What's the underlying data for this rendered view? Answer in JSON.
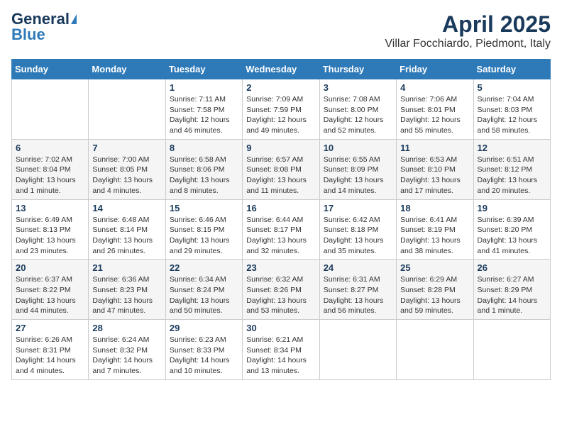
{
  "header": {
    "logo_general": "General",
    "logo_blue": "Blue",
    "title": "April 2025",
    "subtitle": "Villar Focchiardo, Piedmont, Italy"
  },
  "days_of_week": [
    "Sunday",
    "Monday",
    "Tuesday",
    "Wednesday",
    "Thursday",
    "Friday",
    "Saturday"
  ],
  "weeks": [
    [
      {
        "day": "",
        "detail": ""
      },
      {
        "day": "",
        "detail": ""
      },
      {
        "day": "1",
        "detail": "Sunrise: 7:11 AM\nSunset: 7:58 PM\nDaylight: 12 hours and 46 minutes."
      },
      {
        "day": "2",
        "detail": "Sunrise: 7:09 AM\nSunset: 7:59 PM\nDaylight: 12 hours and 49 minutes."
      },
      {
        "day": "3",
        "detail": "Sunrise: 7:08 AM\nSunset: 8:00 PM\nDaylight: 12 hours and 52 minutes."
      },
      {
        "day": "4",
        "detail": "Sunrise: 7:06 AM\nSunset: 8:01 PM\nDaylight: 12 hours and 55 minutes."
      },
      {
        "day": "5",
        "detail": "Sunrise: 7:04 AM\nSunset: 8:03 PM\nDaylight: 12 hours and 58 minutes."
      }
    ],
    [
      {
        "day": "6",
        "detail": "Sunrise: 7:02 AM\nSunset: 8:04 PM\nDaylight: 13 hours and 1 minute."
      },
      {
        "day": "7",
        "detail": "Sunrise: 7:00 AM\nSunset: 8:05 PM\nDaylight: 13 hours and 4 minutes."
      },
      {
        "day": "8",
        "detail": "Sunrise: 6:58 AM\nSunset: 8:06 PM\nDaylight: 13 hours and 8 minutes."
      },
      {
        "day": "9",
        "detail": "Sunrise: 6:57 AM\nSunset: 8:08 PM\nDaylight: 13 hours and 11 minutes."
      },
      {
        "day": "10",
        "detail": "Sunrise: 6:55 AM\nSunset: 8:09 PM\nDaylight: 13 hours and 14 minutes."
      },
      {
        "day": "11",
        "detail": "Sunrise: 6:53 AM\nSunset: 8:10 PM\nDaylight: 13 hours and 17 minutes."
      },
      {
        "day": "12",
        "detail": "Sunrise: 6:51 AM\nSunset: 8:12 PM\nDaylight: 13 hours and 20 minutes."
      }
    ],
    [
      {
        "day": "13",
        "detail": "Sunrise: 6:49 AM\nSunset: 8:13 PM\nDaylight: 13 hours and 23 minutes."
      },
      {
        "day": "14",
        "detail": "Sunrise: 6:48 AM\nSunset: 8:14 PM\nDaylight: 13 hours and 26 minutes."
      },
      {
        "day": "15",
        "detail": "Sunrise: 6:46 AM\nSunset: 8:15 PM\nDaylight: 13 hours and 29 minutes."
      },
      {
        "day": "16",
        "detail": "Sunrise: 6:44 AM\nSunset: 8:17 PM\nDaylight: 13 hours and 32 minutes."
      },
      {
        "day": "17",
        "detail": "Sunrise: 6:42 AM\nSunset: 8:18 PM\nDaylight: 13 hours and 35 minutes."
      },
      {
        "day": "18",
        "detail": "Sunrise: 6:41 AM\nSunset: 8:19 PM\nDaylight: 13 hours and 38 minutes."
      },
      {
        "day": "19",
        "detail": "Sunrise: 6:39 AM\nSunset: 8:20 PM\nDaylight: 13 hours and 41 minutes."
      }
    ],
    [
      {
        "day": "20",
        "detail": "Sunrise: 6:37 AM\nSunset: 8:22 PM\nDaylight: 13 hours and 44 minutes."
      },
      {
        "day": "21",
        "detail": "Sunrise: 6:36 AM\nSunset: 8:23 PM\nDaylight: 13 hours and 47 minutes."
      },
      {
        "day": "22",
        "detail": "Sunrise: 6:34 AM\nSunset: 8:24 PM\nDaylight: 13 hours and 50 minutes."
      },
      {
        "day": "23",
        "detail": "Sunrise: 6:32 AM\nSunset: 8:26 PM\nDaylight: 13 hours and 53 minutes."
      },
      {
        "day": "24",
        "detail": "Sunrise: 6:31 AM\nSunset: 8:27 PM\nDaylight: 13 hours and 56 minutes."
      },
      {
        "day": "25",
        "detail": "Sunrise: 6:29 AM\nSunset: 8:28 PM\nDaylight: 13 hours and 59 minutes."
      },
      {
        "day": "26",
        "detail": "Sunrise: 6:27 AM\nSunset: 8:29 PM\nDaylight: 14 hours and 1 minute."
      }
    ],
    [
      {
        "day": "27",
        "detail": "Sunrise: 6:26 AM\nSunset: 8:31 PM\nDaylight: 14 hours and 4 minutes."
      },
      {
        "day": "28",
        "detail": "Sunrise: 6:24 AM\nSunset: 8:32 PM\nDaylight: 14 hours and 7 minutes."
      },
      {
        "day": "29",
        "detail": "Sunrise: 6:23 AM\nSunset: 8:33 PM\nDaylight: 14 hours and 10 minutes."
      },
      {
        "day": "30",
        "detail": "Sunrise: 6:21 AM\nSunset: 8:34 PM\nDaylight: 14 hours and 13 minutes."
      },
      {
        "day": "",
        "detail": ""
      },
      {
        "day": "",
        "detail": ""
      },
      {
        "day": "",
        "detail": ""
      }
    ]
  ]
}
